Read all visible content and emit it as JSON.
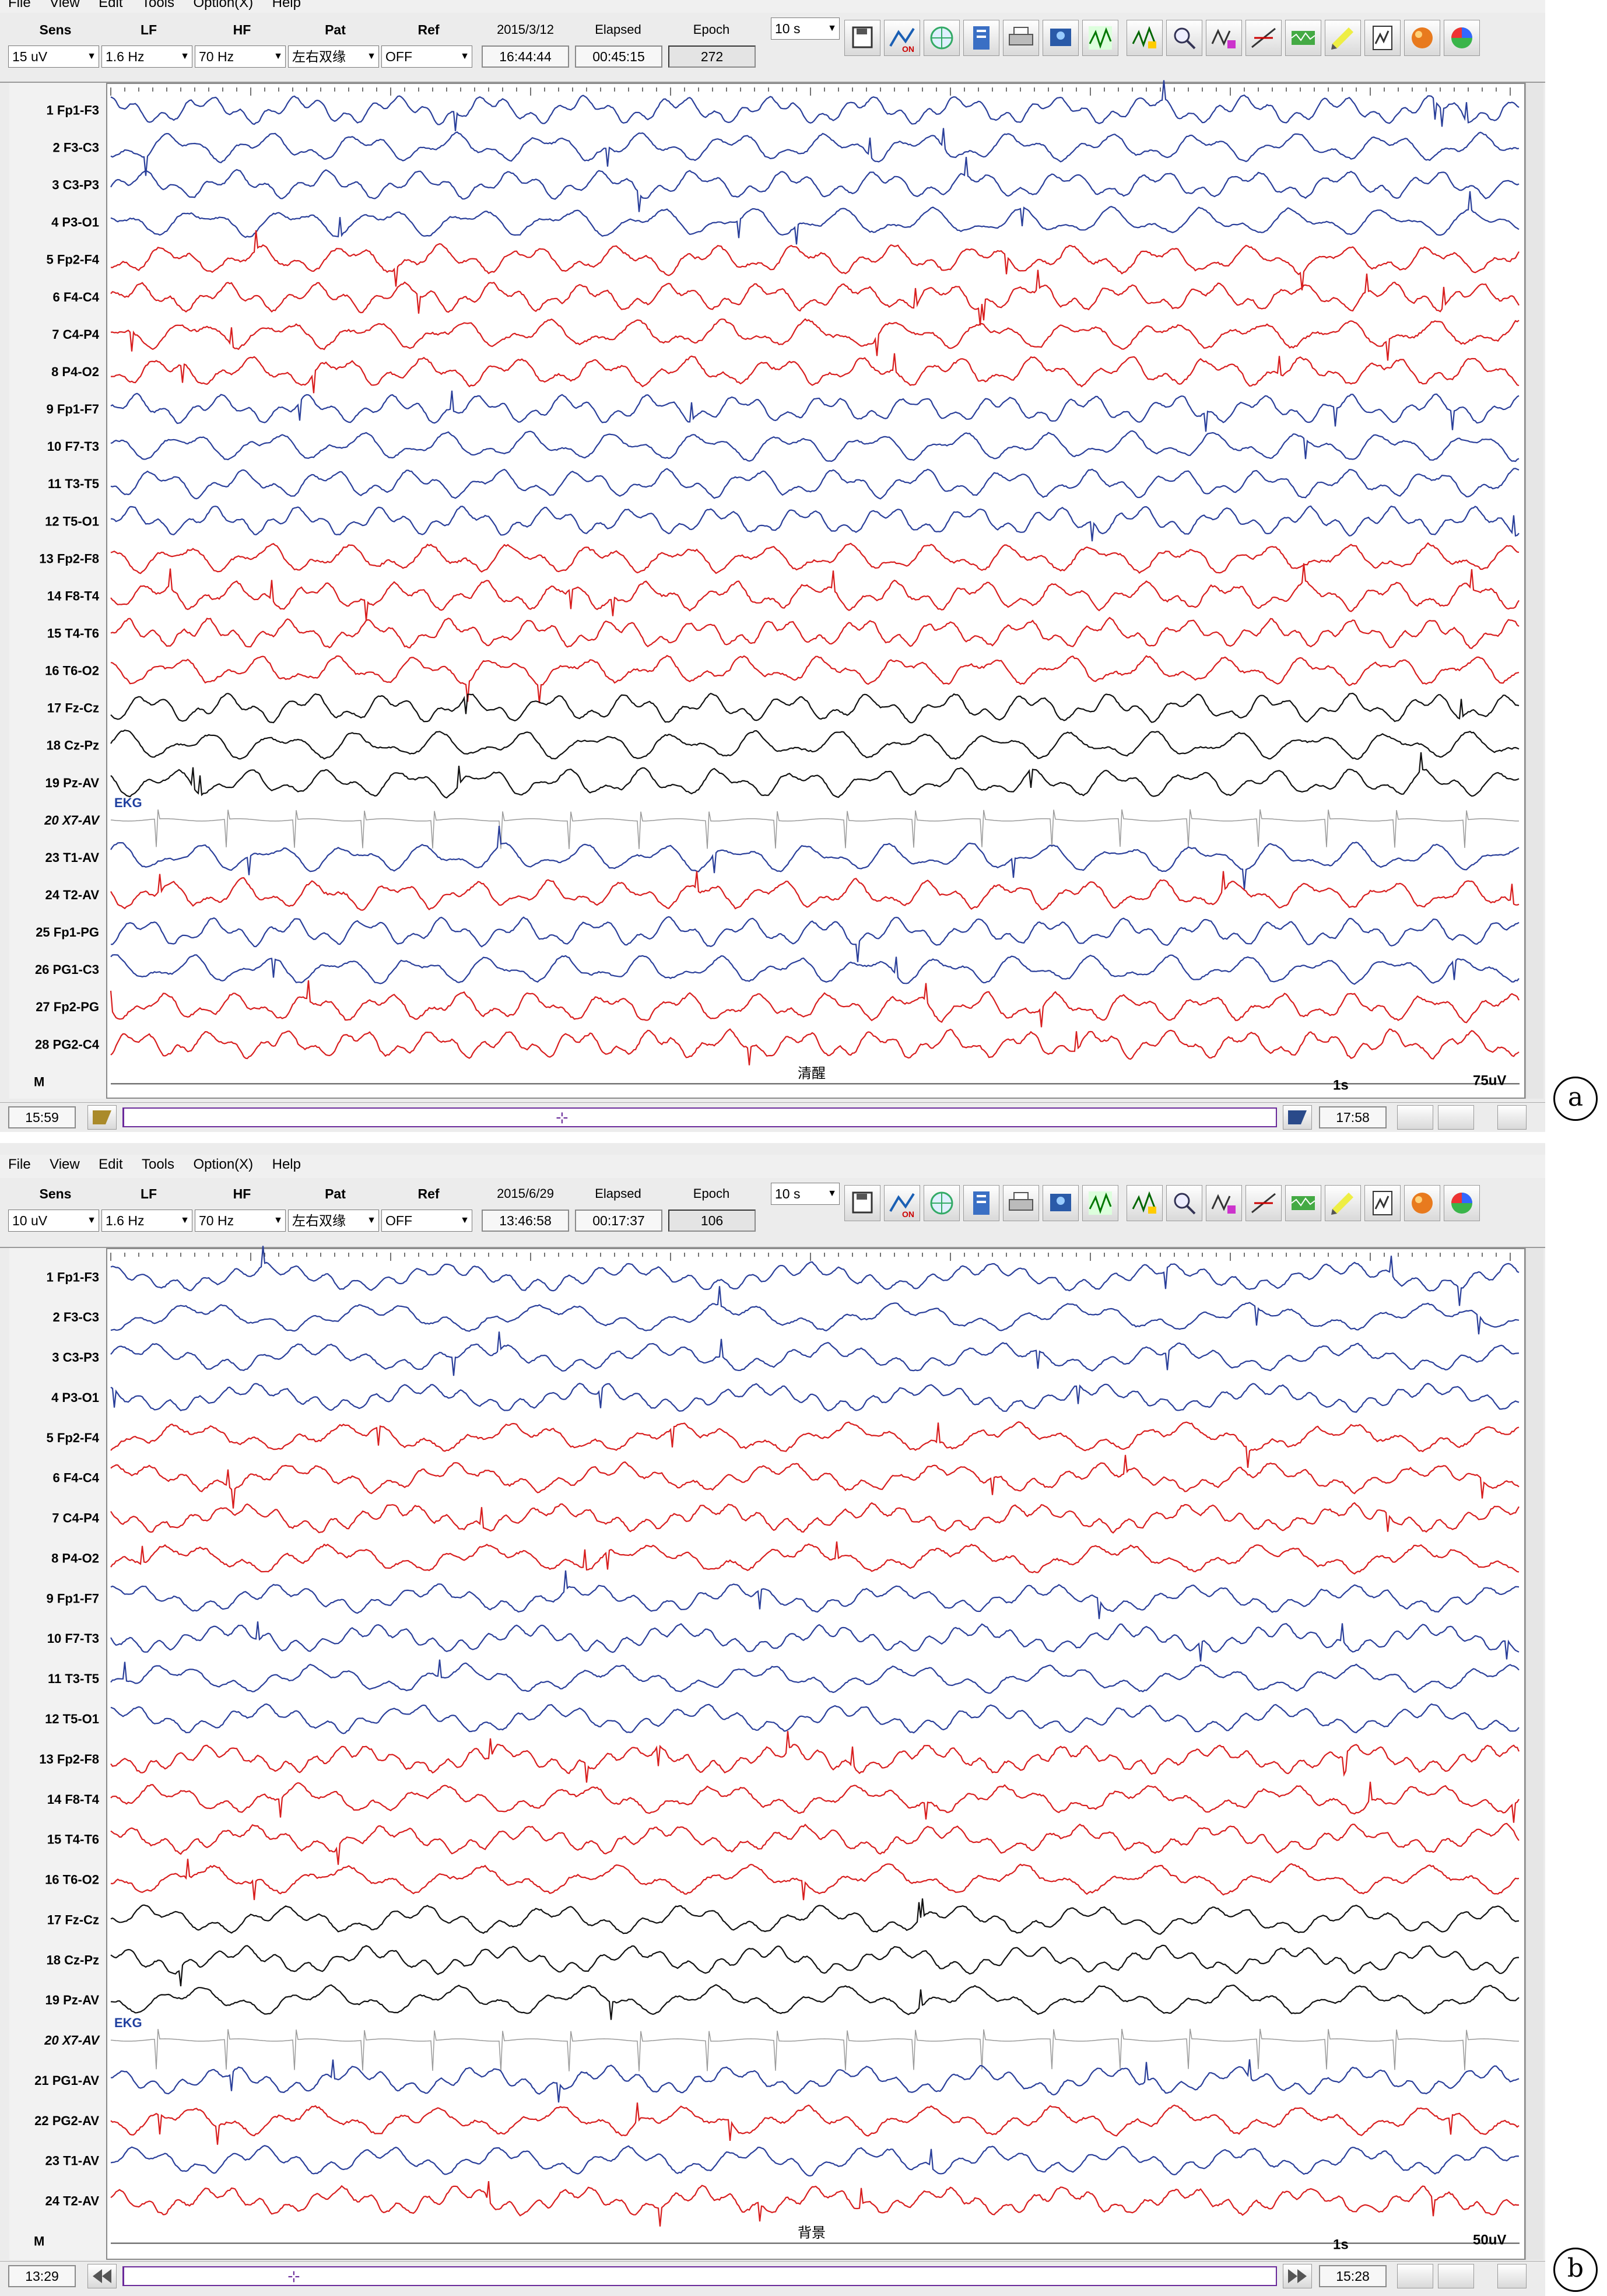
{
  "menu": [
    "File",
    "View",
    "Edit",
    "Tools",
    "Option(X)",
    "Help"
  ],
  "panels": [
    {
      "id": "a",
      "badge": "a",
      "controls": {
        "sens_label": "Sens",
        "lf_label": "LF",
        "hf_label": "HF",
        "pat_label": "Pat",
        "ref_label": "Ref",
        "date": "2015/3/12",
        "elapsed_label": "Elapsed",
        "epoch_label": "Epoch",
        "sens": "15 uV",
        "lf": "1.6 Hz",
        "hf": "70 Hz",
        "pat": "左右双缘",
        "ref": "OFF",
        "clock": "16:44:44",
        "elapsed": "00:45:15",
        "epoch": "272",
        "timebase": "10 s"
      },
      "channels": [
        {
          "num": "1",
          "name": "Fp1-F3",
          "color": "blue"
        },
        {
          "num": "2",
          "name": "F3-C3",
          "color": "blue"
        },
        {
          "num": "3",
          "name": "C3-P3",
          "color": "blue"
        },
        {
          "num": "4",
          "name": "P3-O1",
          "color": "blue"
        },
        {
          "num": "5",
          "name": "Fp2-F4",
          "color": "red"
        },
        {
          "num": "6",
          "name": "F4-C4",
          "color": "red"
        },
        {
          "num": "7",
          "name": "C4-P4",
          "color": "red"
        },
        {
          "num": "8",
          "name": "P4-O2",
          "color": "red"
        },
        {
          "num": "9",
          "name": "Fp1-F7",
          "color": "blue"
        },
        {
          "num": "10",
          "name": "F7-T3",
          "color": "blue"
        },
        {
          "num": "11",
          "name": "T3-T5",
          "color": "blue"
        },
        {
          "num": "12",
          "name": "T5-O1",
          "color": "blue"
        },
        {
          "num": "13",
          "name": "Fp2-F8",
          "color": "red"
        },
        {
          "num": "14",
          "name": "F8-T4",
          "color": "red"
        },
        {
          "num": "15",
          "name": "T4-T6",
          "color": "red"
        },
        {
          "num": "16",
          "name": "T6-O2",
          "color": "red"
        },
        {
          "num": "17",
          "name": "Fz-Cz",
          "color": "black"
        },
        {
          "num": "18",
          "name": "Cz-Pz",
          "color": "black"
        },
        {
          "num": "19",
          "name": "Pz-AV",
          "color": "black"
        },
        {
          "num": "20",
          "name": "X7-AV",
          "color": "ekg"
        },
        {
          "num": "23",
          "name": "T1-AV",
          "color": "blue"
        },
        {
          "num": "24",
          "name": "T2-AV",
          "color": "red"
        },
        {
          "num": "25",
          "name": "Fp1-PG",
          "color": "blue"
        },
        {
          "num": "26",
          "name": "PG1-C3",
          "color": "blue"
        },
        {
          "num": "27",
          "name": "Fp2-PG",
          "color": "red"
        },
        {
          "num": "28",
          "name": "PG2-C4",
          "color": "red"
        }
      ],
      "marker_row": "M",
      "ekg_label": "EKG",
      "event_text": "清醒",
      "time_scale": "1s",
      "amp_scale": "75uV",
      "status": {
        "start": "15:59",
        "end": "17:58"
      }
    },
    {
      "id": "b",
      "badge": "b",
      "controls": {
        "sens_label": "Sens",
        "lf_label": "LF",
        "hf_label": "HF",
        "pat_label": "Pat",
        "ref_label": "Ref",
        "date": "2015/6/29",
        "elapsed_label": "Elapsed",
        "epoch_label": "Epoch",
        "sens": "10 uV",
        "lf": "1.6 Hz",
        "hf": "70 Hz",
        "pat": "左右双缘",
        "ref": "OFF",
        "clock": "13:46:58",
        "elapsed": "00:17:37",
        "epoch": "106",
        "timebase": "10 s"
      },
      "channels": [
        {
          "num": "1",
          "name": "Fp1-F3",
          "color": "blue"
        },
        {
          "num": "2",
          "name": "F3-C3",
          "color": "blue"
        },
        {
          "num": "3",
          "name": "C3-P3",
          "color": "blue"
        },
        {
          "num": "4",
          "name": "P3-O1",
          "color": "blue"
        },
        {
          "num": "5",
          "name": "Fp2-F4",
          "color": "red"
        },
        {
          "num": "6",
          "name": "F4-C4",
          "color": "red"
        },
        {
          "num": "7",
          "name": "C4-P4",
          "color": "red"
        },
        {
          "num": "8",
          "name": "P4-O2",
          "color": "red"
        },
        {
          "num": "9",
          "name": "Fp1-F7",
          "color": "blue"
        },
        {
          "num": "10",
          "name": "F7-T3",
          "color": "blue"
        },
        {
          "num": "11",
          "name": "T3-T5",
          "color": "blue"
        },
        {
          "num": "12",
          "name": "T5-O1",
          "color": "blue"
        },
        {
          "num": "13",
          "name": "Fp2-F8",
          "color": "red"
        },
        {
          "num": "14",
          "name": "F8-T4",
          "color": "red"
        },
        {
          "num": "15",
          "name": "T4-T6",
          "color": "red"
        },
        {
          "num": "16",
          "name": "T6-O2",
          "color": "red"
        },
        {
          "num": "17",
          "name": "Fz-Cz",
          "color": "black"
        },
        {
          "num": "18",
          "name": "Cz-Pz",
          "color": "black"
        },
        {
          "num": "19",
          "name": "Pz-AV",
          "color": "black"
        },
        {
          "num": "20",
          "name": "X7-AV",
          "color": "ekg"
        },
        {
          "num": "21",
          "name": "PG1-AV",
          "color": "blue"
        },
        {
          "num": "22",
          "name": "PG2-AV",
          "color": "red"
        },
        {
          "num": "23",
          "name": "T1-AV",
          "color": "blue"
        },
        {
          "num": "24",
          "name": "T2-AV",
          "color": "red"
        }
      ],
      "marker_row": "M",
      "ekg_label": "EKG",
      "event_text": "背景",
      "time_scale": "1s",
      "amp_scale": "50uV",
      "status": {
        "start": "13:29",
        "end": "15:28"
      }
    }
  ],
  "trace_colors": {
    "blue": "#2a3f9a",
    "red": "#d81e1e",
    "black": "#111111",
    "ekg": "#9a9a9a"
  }
}
